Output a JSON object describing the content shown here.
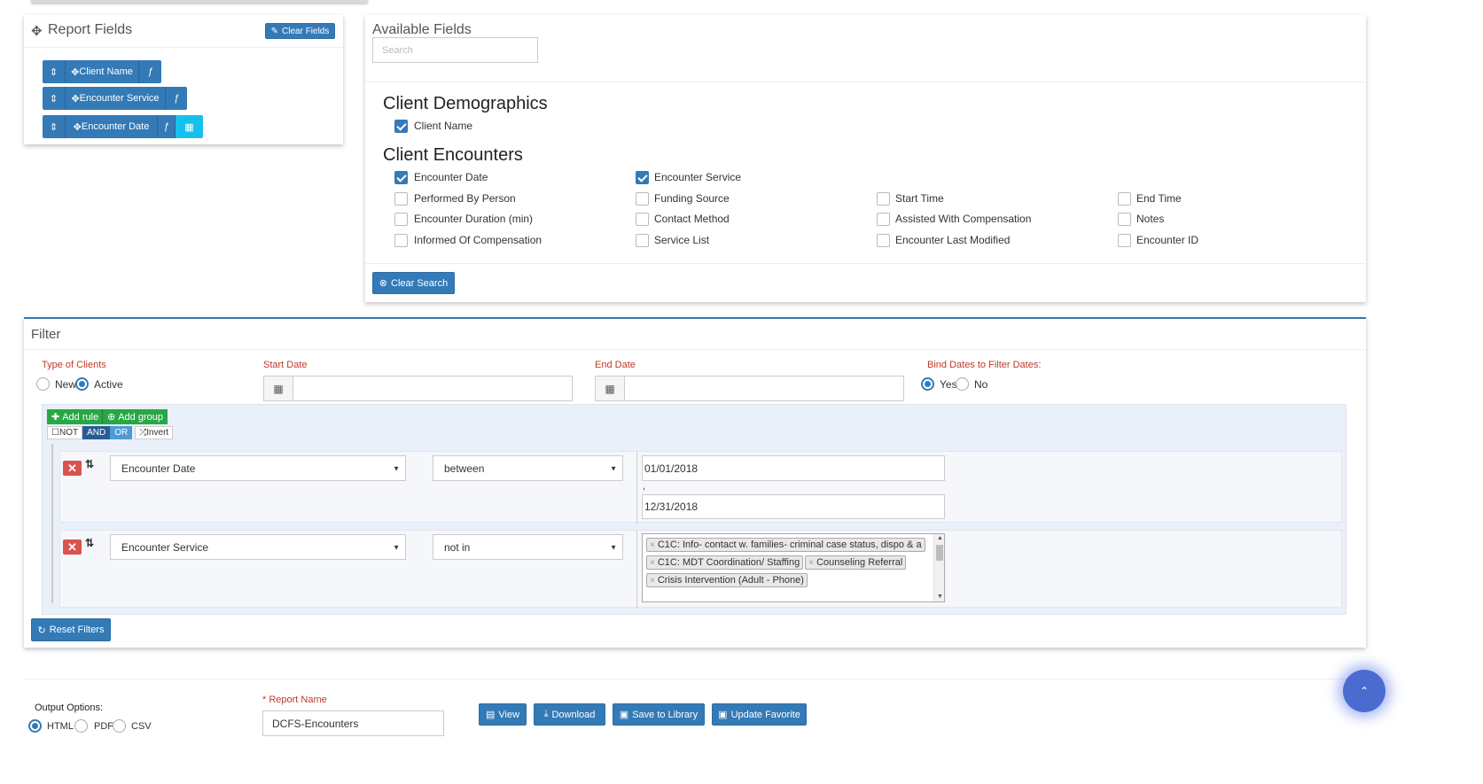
{
  "report_fields": {
    "title": "Report Fields",
    "clear_label": "Clear Fields",
    "fields": [
      {
        "label": "Client Name",
        "fx": "ƒ"
      },
      {
        "label": "Encounter Service",
        "fx": "ƒ"
      },
      {
        "label": "Encounter Date",
        "fx": "ƒ"
      }
    ]
  },
  "available_fields": {
    "title": "Available Fields",
    "search_placeholder": "Search",
    "sections": [
      {
        "heading": "Client Demographics",
        "items": [
          {
            "label": "Client Name",
            "checked": true
          }
        ]
      },
      {
        "heading": "Client Encounters",
        "items": [
          {
            "label": "Encounter Date",
            "checked": true
          },
          {
            "label": "Encounter Service",
            "checked": true
          },
          {
            "label": "Performed By Person",
            "checked": false
          },
          {
            "label": "Funding Source",
            "checked": false
          },
          {
            "label": "Start Time",
            "checked": false
          },
          {
            "label": "End Time",
            "checked": false
          },
          {
            "label": "Encounter Duration (min)",
            "checked": false
          },
          {
            "label": "Contact Method",
            "checked": false
          },
          {
            "label": "Assisted With Compensation",
            "checked": false
          },
          {
            "label": "Notes",
            "checked": false
          },
          {
            "label": "Informed Of Compensation",
            "checked": false
          },
          {
            "label": "Service List",
            "checked": false
          },
          {
            "label": "Encounter Last Modified",
            "checked": false
          },
          {
            "label": "Encounter ID",
            "checked": false
          }
        ]
      }
    ],
    "clear_search_label": "Clear Search"
  },
  "filter": {
    "title": "Filter",
    "type_of_clients_label": "Type of Clients",
    "type_options": [
      "New",
      "Active"
    ],
    "type_selected": "Active",
    "start_date_label": "Start Date",
    "start_date_value": "",
    "end_date_label": "End Date",
    "end_date_value": "",
    "bind_label": "Bind Dates to Filter Dates:",
    "bind_options": [
      "Yes",
      "No"
    ],
    "bind_selected": "Yes",
    "add_rule_label": "Add rule",
    "add_group_label": "Add group",
    "not_label": "NOT",
    "and_label": "AND",
    "or_label": "OR",
    "invert_label": "Invert",
    "rules": [
      {
        "field": "Encounter Date",
        "operator": "between",
        "value1": "01/01/2018",
        "separator": ",",
        "value2": "12/31/2018"
      },
      {
        "field": "Encounter Service",
        "operator": "not in",
        "tags": [
          "C1C: Info- contact w. families- criminal case status, dispo & a",
          "C1C: MDT Coordination/ Staffing",
          "Counseling Referral",
          "Crisis Intervention (Adult - Phone)"
        ]
      }
    ],
    "reset_label": "Reset Filters"
  },
  "output": {
    "options_label": "Output Options:",
    "formats": [
      "HTML",
      "PDF",
      "CSV"
    ],
    "selected_format": "HTML",
    "report_name_label": "* Report Name",
    "report_name_value": "DCFS-Encounters",
    "buttons": {
      "view": "View",
      "download": "Download",
      "save": "Save to Library",
      "update": "Update Favorite"
    }
  },
  "colors": {
    "primary": "#337ab7",
    "success": "#28a745",
    "danger": "#d9534f",
    "calendar": "#17c0eb",
    "label_red": "#c0392b"
  }
}
